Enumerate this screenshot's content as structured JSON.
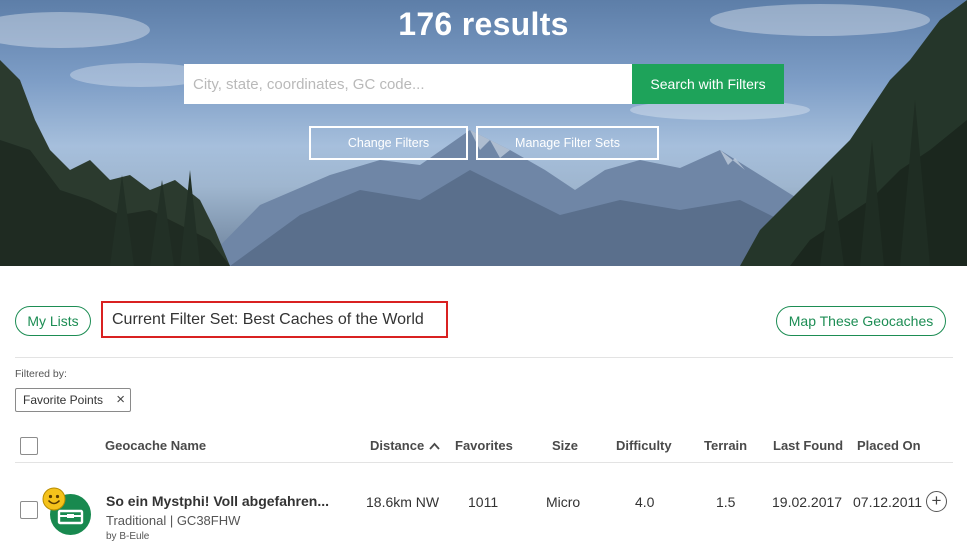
{
  "header": {
    "results_title": "176 results",
    "search_placeholder": "City, state, coordinates, GC code...",
    "search_button_label": "Search with Filters",
    "change_filters_label": "Change Filters",
    "manage_filter_sets_label": "Manage Filter Sets"
  },
  "toolbar": {
    "my_lists_label": "My Lists",
    "current_filter_set": "Current Filter Set: Best Caches of the World",
    "map_button_label": "Map These Geocaches"
  },
  "filters": {
    "filtered_by_label": "Filtered by:",
    "chips": [
      {
        "label": "Favorite Points",
        "remove_glyph": "×"
      }
    ]
  },
  "table": {
    "columns": {
      "name": "Geocache Name",
      "distance": "Distance",
      "favorites": "Favorites",
      "size": "Size",
      "difficulty": "Difficulty",
      "terrain": "Terrain",
      "last_found": "Last Found",
      "placed_on": "Placed On"
    },
    "sort": {
      "column": "distance",
      "direction": "ascending",
      "icon": "chevron-up-icon"
    },
    "rows": [
      {
        "name": "So ein Mystphi! Voll abgefahren...",
        "type_code": "Traditional | GC38FHW",
        "owner": "by B-Eule",
        "distance": "18.6km NW",
        "favorites": "1011",
        "size": "Micro",
        "difficulty": "4.0",
        "terrain": "1.5",
        "last_found": "19.02.2017",
        "placed_on": "07.12.2011",
        "icon": "traditional-cache-icon",
        "badge_icon": "smiley-found-icon",
        "add_glyph": "+"
      }
    ]
  },
  "colors": {
    "brand_green": "#1ea35a",
    "outline_green": "#1d8d54",
    "highlight_red": "#d92121"
  }
}
